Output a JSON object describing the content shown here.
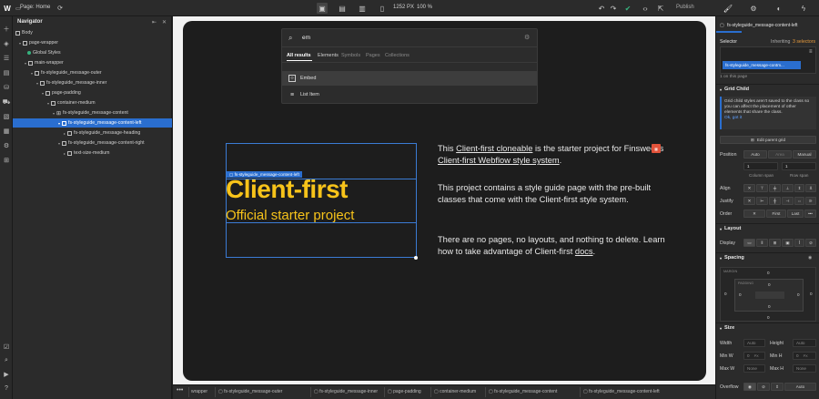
{
  "topbar": {
    "page_label": "Page: Home",
    "width_value": "1252",
    "width_unit": "PX",
    "zoom": "100 %",
    "publish_label": "Publish"
  },
  "navigator": {
    "title": "Navigator",
    "items": [
      {
        "label": "Body"
      },
      {
        "label": "page-wrapper"
      },
      {
        "label": "Global Styles"
      },
      {
        "label": "main-wrapper"
      },
      {
        "label": "fs-styleguide_message-outer"
      },
      {
        "label": "fs-styleguide_message-inner"
      },
      {
        "label": "page-padding"
      },
      {
        "label": "container-medium"
      },
      {
        "label": "fs-styleguide_message-content"
      },
      {
        "label": "fs-styleguide_message-content-left"
      },
      {
        "label": "fs-styleguide_message-heading"
      },
      {
        "label": "fs-styleguide_message-content-right"
      },
      {
        "label": "text-size-medium"
      }
    ]
  },
  "search": {
    "query": "em",
    "tabs": [
      "All results",
      "Elements",
      "Symbols",
      "Pages",
      "Collections"
    ],
    "results": [
      {
        "label": "Embed"
      },
      {
        "label": "List Item"
      }
    ]
  },
  "canvas": {
    "selected_label": "fs-styleguide_message-content-left",
    "heading": "Client-first",
    "subheading": "Official starter project",
    "para1": {
      "t1": "This ",
      "link1": "Client-first cloneable",
      "t2": " is the starter project for Finsweet's ",
      "link2": "Client-first Webflow style system",
      "t3": "."
    },
    "para2": "This project contains a style guide page with the pre-built classes that come with the Client-first style system.",
    "para3": {
      "t1": "There are no pages, no layouts, and nothing to delete. Learn how to take advantage of Client-first ",
      "link": "docs",
      "t2": "."
    }
  },
  "breadcrumbs": [
    "wrapper",
    "fs-styleguide_message-outer",
    "fs-styleguide_message-inner",
    "page-padding",
    "container-medium",
    "fs-styleguide_message-content",
    "fs-styleguide_message-content-left"
  ],
  "right_panel": {
    "element_name": "fs-styleguide_message-content-left",
    "selector_label": "Selector",
    "inheriting": "Inheriting",
    "inheriting_count": "3 selectors",
    "selector_chip": "fs-styleguide_message-contm...",
    "on_page": "1 on this page",
    "grid_child": {
      "title": "Grid Child",
      "note": "Grid child styles aren't saved to the class so you can affect the placement of other elements that share the class.",
      "ok": "Ok, got it",
      "edit_parent": "Edit parent grid",
      "position_label": "Position",
      "position_options": [
        "Auto",
        "Area",
        "Manual"
      ],
      "col_value": "1",
      "row_value": "1",
      "column_span": "Column span",
      "row_span": "Row span",
      "align_label": "Align",
      "justify_label": "Justify",
      "order_label": "Order",
      "order_options": [
        "First",
        "Last"
      ]
    },
    "layout": {
      "title": "Layout",
      "display_label": "Display"
    },
    "spacing": {
      "title": "Spacing",
      "margin_label": "MARGIN",
      "padding_label": "PADDING",
      "margin_values": [
        "0",
        "0",
        "0",
        "0"
      ],
      "padding_values": [
        "0",
        "0",
        "0",
        "0"
      ]
    },
    "size": {
      "title": "Size",
      "width_label": "Width",
      "height_label": "Height",
      "min_w_label": "Min W",
      "min_h_label": "Min H",
      "max_w_label": "Max W",
      "max_h_label": "Max H",
      "auto": "Auto",
      "zero": "0",
      "px": "PX",
      "none": "None",
      "overflow_label": "Overflow",
      "overflow_auto": "Auto"
    }
  }
}
